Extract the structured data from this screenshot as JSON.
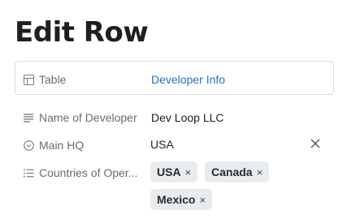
{
  "page": {
    "title": "Edit Row"
  },
  "table_field": {
    "label": "Table",
    "value": "Developer Info"
  },
  "fields": [
    {
      "label": "Name of Developer",
      "value": "Dev Loop LLC",
      "icon": "text-lines-icon"
    },
    {
      "label": "Main HQ",
      "value": "USA",
      "icon": "dropdown-circle-icon"
    },
    {
      "label": "Countries of Oper...",
      "icon": "list-icon",
      "chips": [
        "USA",
        "Canada",
        "Mexico"
      ]
    }
  ],
  "chip_remove_glyph": "×",
  "clear_glyph": "×",
  "colors": {
    "link": "#2a6fc4",
    "chip_bg": "#e9ecef",
    "label": "#6b6b6b"
  }
}
